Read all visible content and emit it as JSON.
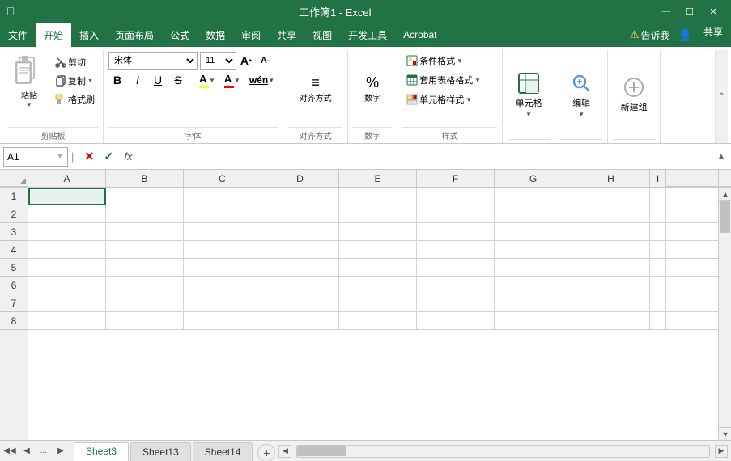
{
  "window": {
    "title": "工作簿1 - Excel"
  },
  "menu": {
    "items": [
      "文件",
      "开始",
      "插入",
      "页面布局",
      "公式",
      "数据",
      "审阅",
      "共享",
      "视图",
      "开发工具",
      "Acrobat"
    ],
    "active": "开始",
    "tell_me": "告诉我",
    "share": "共享"
  },
  "ribbon": {
    "groups": {
      "clipboard": {
        "label": "剪贴板",
        "paste": "粘贴",
        "cut": "剪切",
        "copy": "复制",
        "format_painter": "格式刷"
      },
      "font": {
        "label": "字体",
        "font_name": "宋体",
        "font_size": "11",
        "bold": "B",
        "italic": "I",
        "underline": "U",
        "strikethrough": "S",
        "font_grow": "A",
        "font_shrink": "A",
        "fill_color_label": "A",
        "font_color_label": "A",
        "wen": "wén"
      },
      "alignment": {
        "label": "对齐方式"
      },
      "number": {
        "label": "数字"
      },
      "styles": {
        "label": "样式",
        "conditional": "条件格式",
        "table": "套用表格格式",
        "cell_styles": "单元格样式"
      },
      "cells": {
        "label": "",
        "cell": "单元格"
      },
      "editing": {
        "label": "",
        "edit": "编辑"
      },
      "outline": {
        "label": "",
        "new_group": "新建组"
      }
    }
  },
  "formula_bar": {
    "cell_ref": "A1",
    "cancel": "×",
    "confirm": "✓",
    "fx": "fx"
  },
  "grid": {
    "columns": [
      "A",
      "B",
      "C",
      "D",
      "E",
      "F",
      "G",
      "H",
      "I"
    ],
    "rows": [
      1,
      2,
      3,
      4,
      5,
      6,
      7,
      8
    ]
  },
  "sheets": {
    "nav_dots": "...",
    "tabs": [
      "Sheet3",
      "Sheet13",
      "Sheet14"
    ],
    "active_tab": "Sheet3",
    "add_label": "+"
  }
}
